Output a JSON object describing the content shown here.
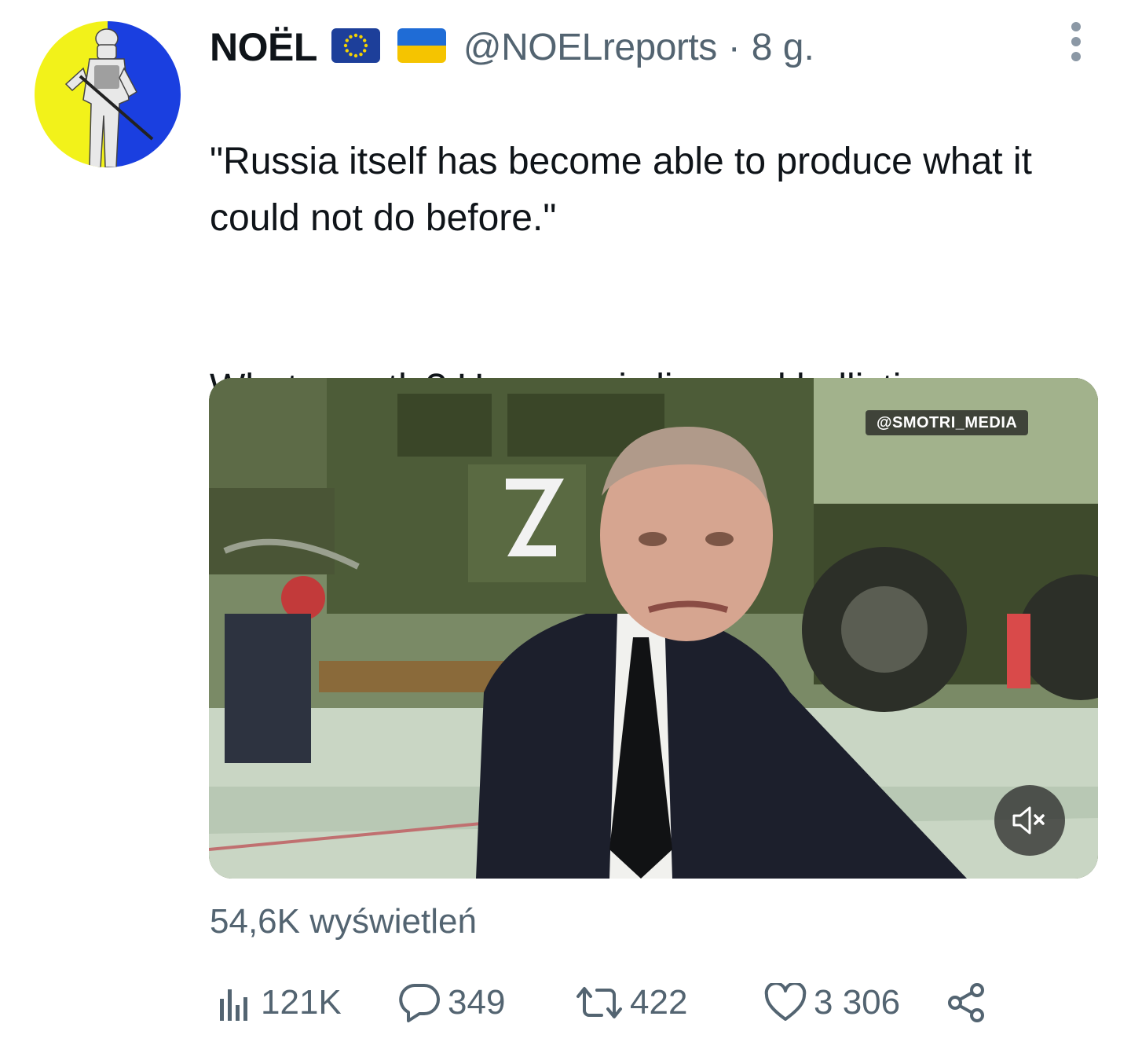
{
  "tweet": {
    "display_name": "NOËL",
    "handle": "@NOELreports",
    "separator": "·",
    "age": "8 g.",
    "flags": [
      "eu-flag-icon",
      "ukraine-flag-icon"
    ],
    "text_paragraphs": [
      "\"Russia itself has become able to produce what it could not do before.\"",
      "What exactly? Hypersonic lies and ballistic nonsense?"
    ],
    "media": {
      "watermark": "@SMOTRI_MEDIA",
      "mute_icon": "mute-speaker-icon"
    },
    "views_text": "54,6K wyświetleń"
  },
  "actions": {
    "analytics": {
      "icon": "analytics-bars-icon",
      "count": "121K"
    },
    "reply": {
      "icon": "reply-bubble-icon",
      "count": "349"
    },
    "retweet": {
      "icon": "retweet-icon",
      "count": "422"
    },
    "like": {
      "icon": "heart-icon",
      "count": "3 306"
    },
    "share": {
      "icon": "share-icon"
    }
  },
  "colors": {
    "text": "#0f1419",
    "secondary": "#536471",
    "avatar_yellow": "#f2f21a",
    "avatar_blue": "#1a3fe0"
  }
}
